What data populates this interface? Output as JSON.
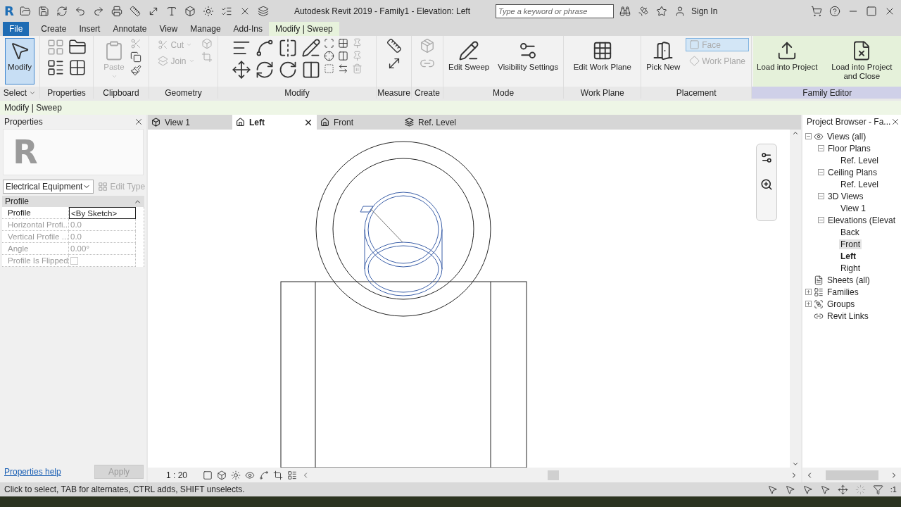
{
  "title_bar": {
    "logo": "R",
    "title": "Autodesk Revit 2019 - Family1 - Elevation: Left",
    "search": {
      "placeholder": "Type a keyword or phrase"
    },
    "sign_in": "Sign In"
  },
  "ribbon_tabs": [
    {
      "label": "File",
      "kind": "file",
      "selected": false
    },
    {
      "label": "Create",
      "kind": "tab",
      "selected": false
    },
    {
      "label": "Insert",
      "kind": "tab",
      "selected": false
    },
    {
      "label": "Annotate",
      "kind": "tab",
      "selected": false
    },
    {
      "label": "View",
      "kind": "tab",
      "selected": false
    },
    {
      "label": "Manage",
      "kind": "tab",
      "selected": false
    },
    {
      "label": "Add-Ins",
      "kind": "tab",
      "selected": false
    },
    {
      "label": "Modify | Sweep",
      "kind": "tab",
      "selected": true
    }
  ],
  "ribbon_panels": [
    {
      "label": "Select",
      "has_menu": true,
      "highlighted": false,
      "tools": [
        {
          "label": "Modify",
          "kind": "large",
          "disabled": false,
          "selected": true,
          "dropdown": false
        }
      ]
    },
    {
      "label": "Properties",
      "has_menu": false,
      "highlighted": false
    },
    {
      "label": "Clipboard",
      "has_menu": false,
      "highlighted": false,
      "tools": [
        {
          "label": "Paste",
          "kind": "large",
          "disabled": true,
          "selected": false,
          "dropdown": true
        }
      ]
    },
    {
      "label": "Geometry",
      "has_menu": false,
      "highlighted": false,
      "tools": [
        {
          "label": "Cut",
          "kind": "small",
          "disabled": true,
          "selected": false,
          "dropdown": true
        },
        {
          "label": "Join",
          "kind": "small",
          "disabled": true,
          "selected": false,
          "dropdown": true
        }
      ]
    },
    {
      "label": "Modify",
      "has_menu": false,
      "highlighted": false
    },
    {
      "label": "Measure",
      "has_menu": false,
      "highlighted": false
    },
    {
      "label": "Create",
      "has_menu": false,
      "highlighted": false
    },
    {
      "label": "Mode",
      "has_menu": false,
      "highlighted": false,
      "tools": [
        {
          "label": "Edit Sweep",
          "kind": "large",
          "disabled": false,
          "selected": false,
          "dropdown": false
        },
        {
          "label": "Visibility Settings",
          "kind": "large",
          "disabled": false,
          "selected": false,
          "dropdown": false
        }
      ]
    },
    {
      "label": "Work Plane",
      "has_menu": false,
      "highlighted": false,
      "tools": [
        {
          "label": "Edit Work Plane",
          "kind": "large",
          "disabled": false,
          "selected": false,
          "dropdown": false
        }
      ]
    },
    {
      "label": "Placement",
      "has_menu": false,
      "highlighted": false,
      "tools": [
        {
          "label": "Pick New",
          "kind": "large",
          "disabled": false,
          "selected": false,
          "dropdown": false
        },
        {
          "label": "Face",
          "kind": "small",
          "disabled": true,
          "selected": true,
          "dropdown": false
        },
        {
          "label": "Work Plane",
          "kind": "small",
          "disabled": true,
          "selected": false,
          "dropdown": false
        }
      ]
    },
    {
      "label": "Family Editor",
      "has_menu": false,
      "highlighted": true,
      "tools": [
        {
          "label": "Load into Project",
          "kind": "large",
          "disabled": false,
          "selected": false,
          "dropdown": false
        },
        {
          "label": "Load into Project and Close",
          "kind": "large",
          "disabled": false,
          "selected": false,
          "dropdown": false
        }
      ]
    }
  ],
  "context_bar": "Modify | Sweep",
  "properties": {
    "title": "Properties",
    "type_preview": "R",
    "type_selector": "Electrical Equipment",
    "edit_type": {
      "label": "Edit Type",
      "disabled": true
    },
    "group": "Profile",
    "rows": [
      {
        "name": "Profile",
        "value": "<By Sketch>",
        "kind": "text",
        "disabled": false
      },
      {
        "name": "Horizontal Profi...",
        "value": "0.0",
        "kind": "text",
        "disabled": true
      },
      {
        "name": "Vertical Profile ...",
        "value": "0.0",
        "kind": "text",
        "disabled": true
      },
      {
        "name": "Angle",
        "value": "0.00°",
        "kind": "text",
        "disabled": true
      },
      {
        "name": "Profile Is Flipped",
        "kind": "checkbox",
        "checked": false,
        "disabled": true
      }
    ],
    "help_link": "Properties help",
    "apply": {
      "label": "Apply",
      "disabled": true
    }
  },
  "view_tabs": [
    {
      "label": "View 1",
      "kind": "perspective",
      "selected": false
    },
    {
      "label": "Left",
      "kind": "elevation",
      "selected": true
    },
    {
      "label": "Front",
      "kind": "elevation",
      "selected": false
    },
    {
      "label": "Ref. Level",
      "kind": "plan",
      "selected": false
    }
  ],
  "view_bar": {
    "scale": "1 : 20"
  },
  "project_browser": {
    "title": "Project Browser - Fa...",
    "items": [
      {
        "label": "Views (all)",
        "kind": "views",
        "expanded": true,
        "selected": false,
        "current": false,
        "children": [
          {
            "label": "Floor Plans",
            "expanded": true,
            "selected": false,
            "current": false,
            "children": [
              {
                "label": "Ref. Level",
                "selected": false,
                "current": false
              }
            ]
          },
          {
            "label": "Ceiling Plans",
            "expanded": true,
            "selected": false,
            "current": false,
            "children": [
              {
                "label": "Ref. Level",
                "selected": false,
                "current": false
              }
            ]
          },
          {
            "label": "3D Views",
            "expanded": true,
            "selected": false,
            "current": false,
            "children": [
              {
                "label": "View 1",
                "selected": false,
                "current": false
              }
            ]
          },
          {
            "label": "Elevations (Elevat",
            "expanded": true,
            "selected": false,
            "current": false,
            "children": [
              {
                "label": "Back",
                "selected": false,
                "current": false
              },
              {
                "label": "Front",
                "selected": true,
                "current": false
              },
              {
                "label": "Left",
                "selected": false,
                "current": true
              },
              {
                "label": "Right",
                "selected": false,
                "current": false
              }
            ]
          }
        ]
      },
      {
        "label": "Sheets (all)",
        "kind": "sheets",
        "selected": false,
        "current": false
      },
      {
        "label": "Families",
        "kind": "families",
        "expanded": false,
        "selected": false,
        "current": false
      },
      {
        "label": "Groups",
        "kind": "groups",
        "expanded": false,
        "selected": false,
        "current": false
      },
      {
        "label": "Revit Links",
        "kind": "links",
        "selected": false,
        "current": false
      }
    ]
  },
  "status_bar": {
    "message": "Click to select, TAB for alternates, CTRL adds, SHIFT unselects.",
    "filter_count": ":1"
  }
}
